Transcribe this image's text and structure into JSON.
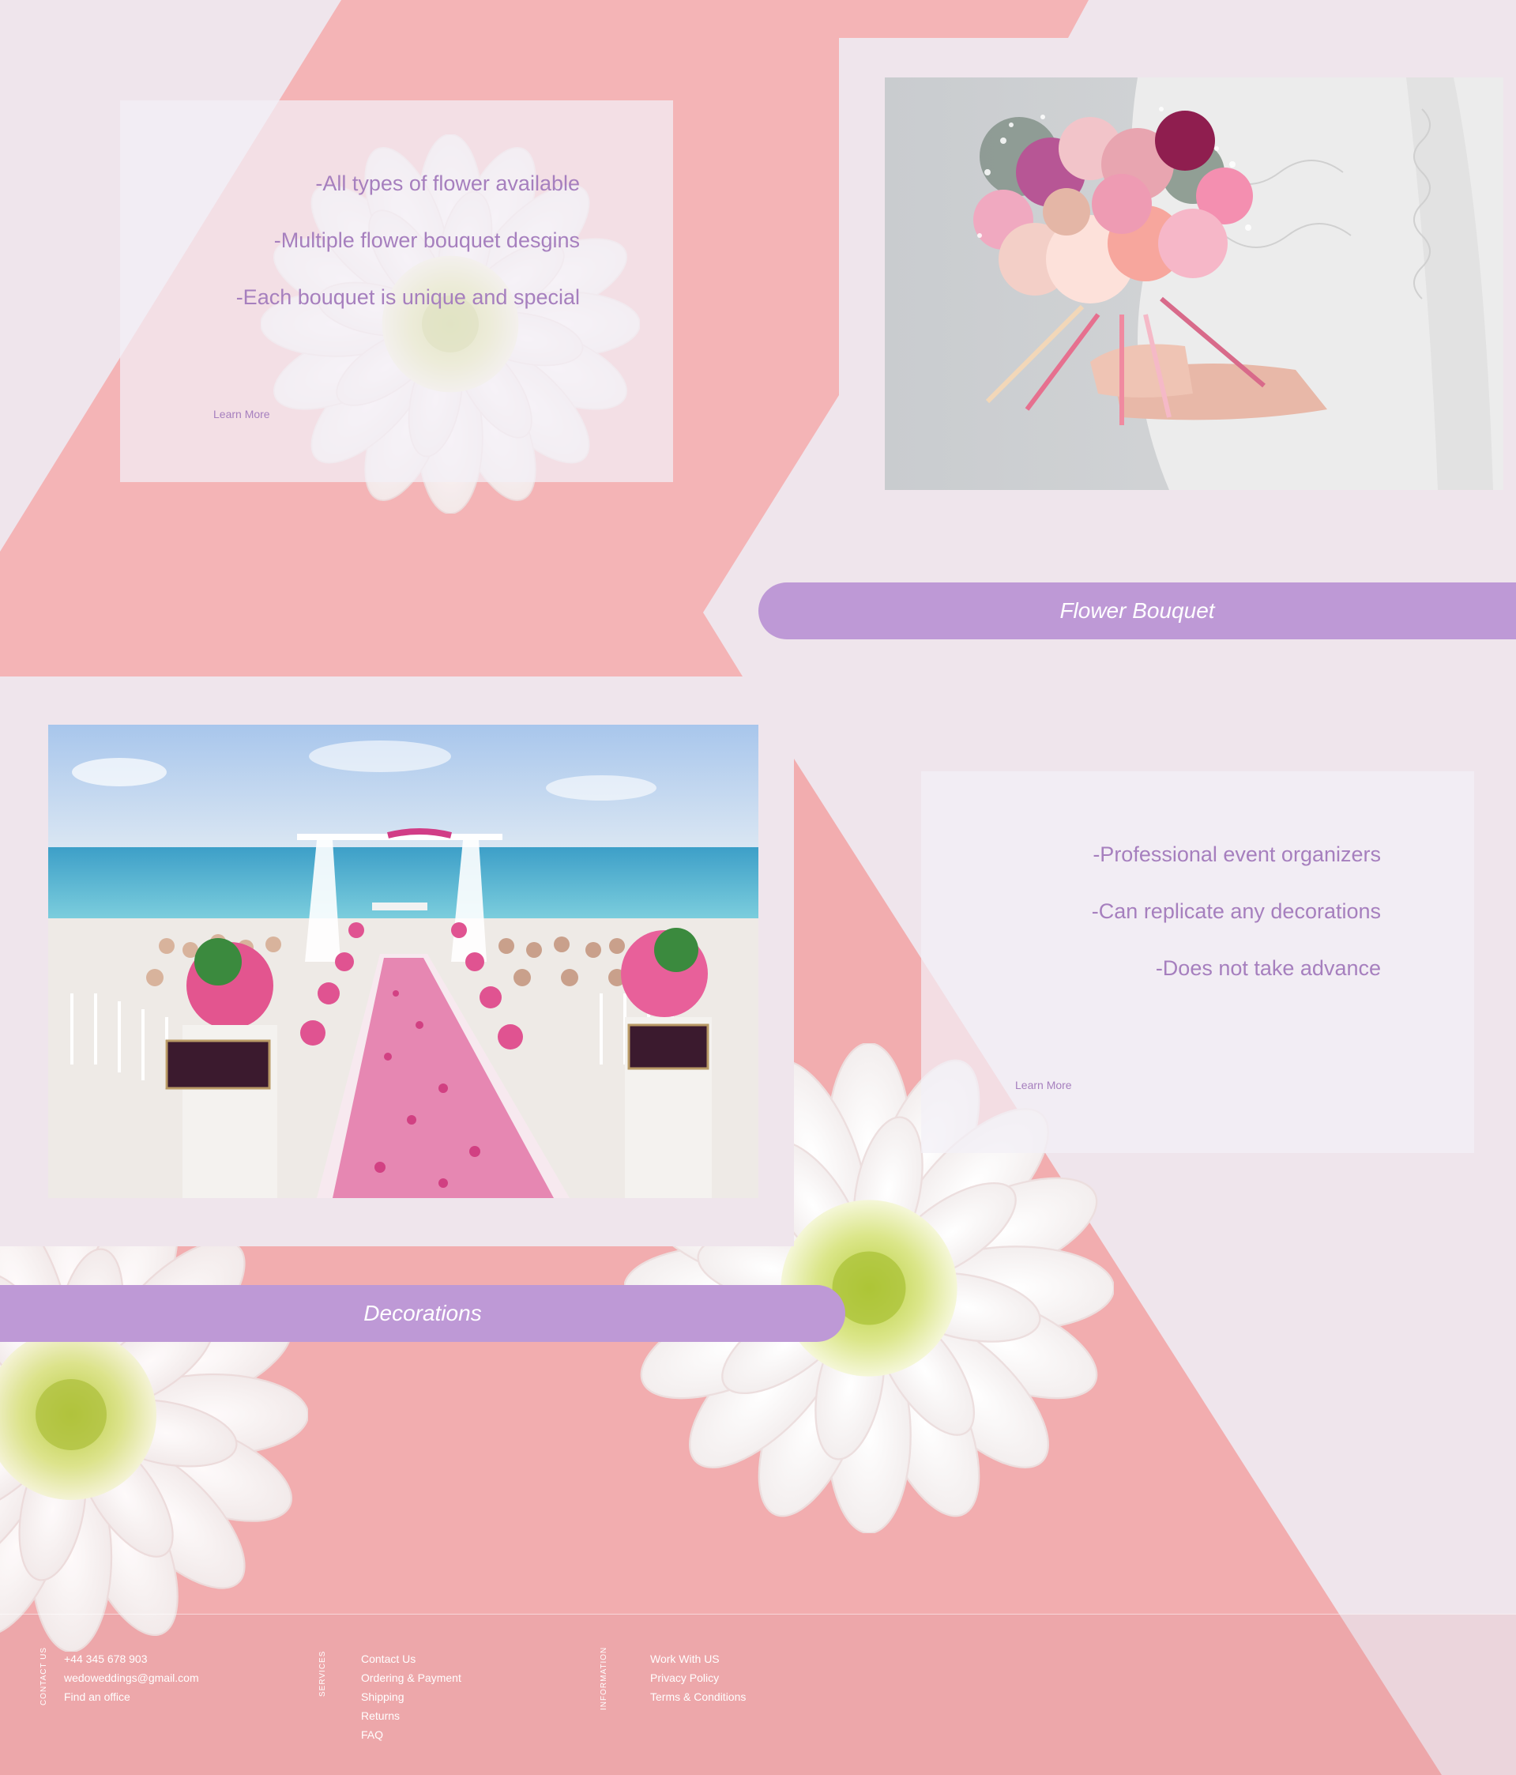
{
  "colors": {
    "background": "#efe5ec",
    "coral": "#f4b4b6",
    "accent_purple": "#be99d6",
    "text_purple": "#a67fbe",
    "footer_text": "#ffffff"
  },
  "bouquet_section": {
    "features": [
      "-All types of flower available",
      "-Multiple flower bouquet desgins",
      "-Each bouquet is unique and special"
    ],
    "learn_more": "Learn More",
    "photo_label": "bride holding pink and white rose bouquet",
    "banner": "Flower Bouquet"
  },
  "decorations_section": {
    "features": [
      "-Professional event organizers",
      "-Can replicate any decorations",
      "-Does not take advance"
    ],
    "learn_more": "Learn More",
    "photo_label": "beach wedding ceremony with flower aisle",
    "banner": "Decorations"
  },
  "footer": {
    "contact": {
      "heading": "CONTACT US",
      "items": [
        "+44 345 678 903",
        "wedoweddings@gmail.com",
        "Find an office"
      ]
    },
    "services": {
      "heading": "SERVICES",
      "items": [
        "Contact Us",
        "Ordering & Payment",
        "Shipping",
        "Returns",
        "FAQ"
      ]
    },
    "information": {
      "heading": "INFORMATION",
      "items": [
        "Work With US",
        "Privacy Policy",
        "Terms & Conditions"
      ]
    }
  }
}
